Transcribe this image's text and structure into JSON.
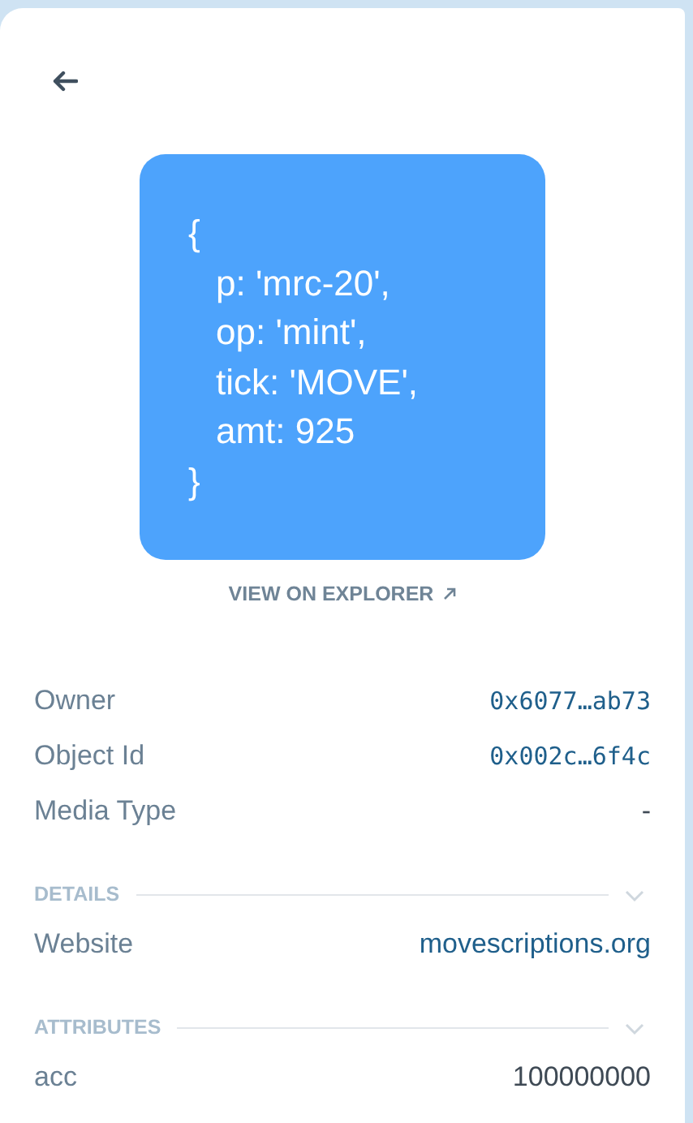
{
  "preview": {
    "lines": [
      {
        "text": "{",
        "indent": false
      },
      {
        "text": "p: 'mrc-20',",
        "indent": true
      },
      {
        "text": "op: 'mint',",
        "indent": true
      },
      {
        "text": "tick: 'MOVE',",
        "indent": true
      },
      {
        "text": "amt: 925",
        "indent": true
      },
      {
        "text": "}",
        "indent": false
      }
    ]
  },
  "explorer_link": "VIEW ON EXPLORER",
  "properties": [
    {
      "label": "Owner",
      "value": "0x6077…ab73",
      "kind": "address"
    },
    {
      "label": "Object Id",
      "value": "0x002c…6f4c",
      "kind": "address"
    },
    {
      "label": "Media Type",
      "value": "-",
      "kind": "plain"
    }
  ],
  "sections": [
    {
      "title": "DETAILS",
      "expanded": true,
      "rows": [
        {
          "label": "Website",
          "value": "movescriptions.org",
          "kind": "link"
        }
      ]
    },
    {
      "title": "ATTRIBUTES",
      "expanded": true,
      "rows": [
        {
          "label": "acc",
          "value": "100000000",
          "kind": "plain"
        }
      ]
    }
  ]
}
